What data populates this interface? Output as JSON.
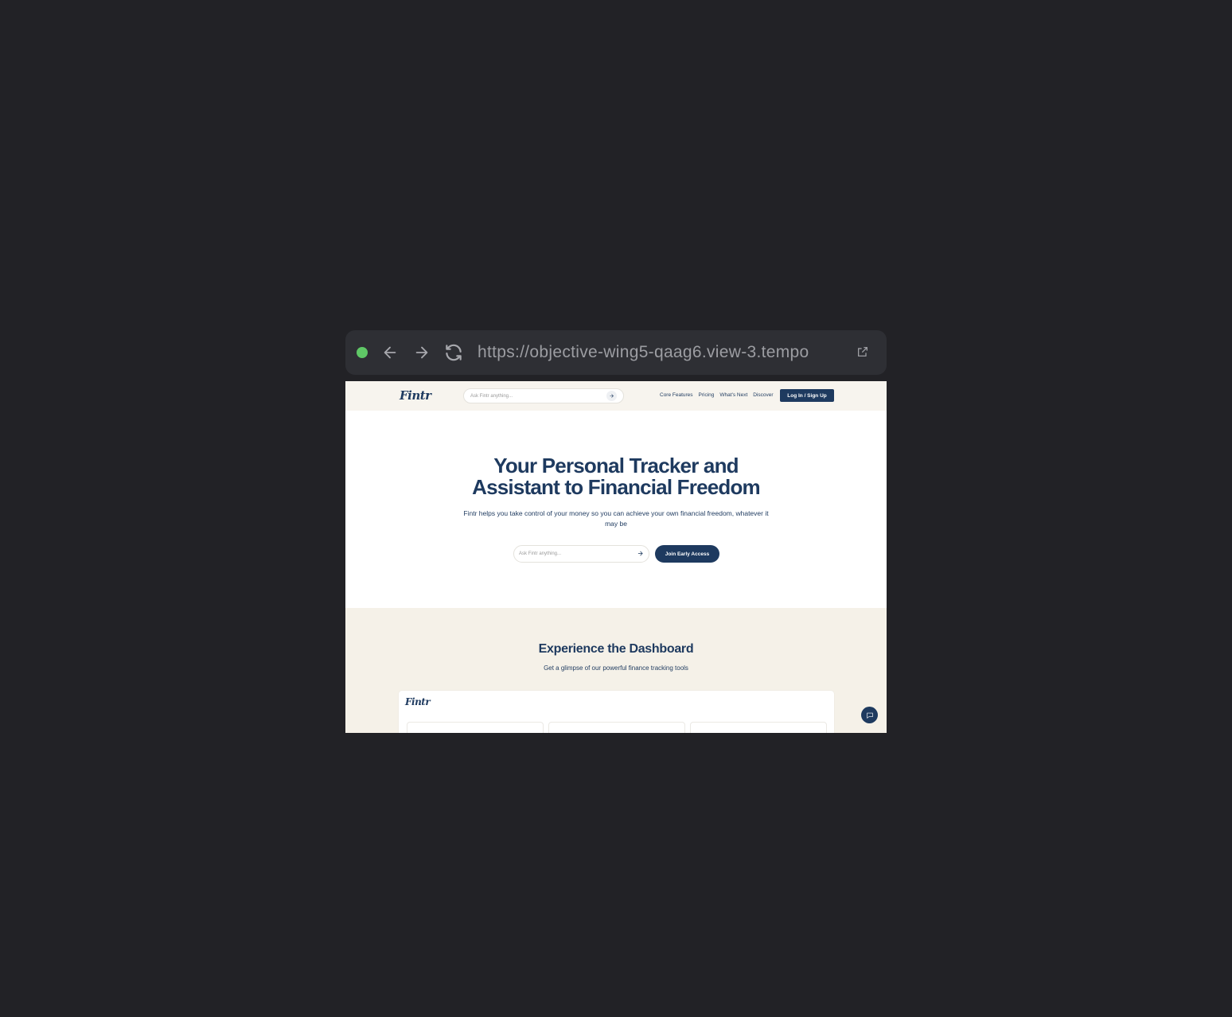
{
  "browser": {
    "url": "https://objective-wing5-qaag6.view-3.tempo",
    "status_color": "#5fc866",
    "icons": [
      "status-dot",
      "back-arrow-icon",
      "forward-arrow-icon",
      "reload-icon",
      "external-link-icon"
    ]
  },
  "site": {
    "brand": "Fintr",
    "brand_color": "#1e3a5f",
    "nav": {
      "search_placeholder": "Ask Fintr anything...",
      "links": [
        "Core Features",
        "Pricing",
        "What's Next",
        "Discover"
      ],
      "login_label": "Log In / Sign Up"
    },
    "hero": {
      "title_line1": "Your Personal Tracker and",
      "title_line2": "Assistant to Financial Freedom",
      "subtitle": "Fintr helps you take control of your money so you can achieve your own financial freedom, whatever it may be",
      "search_placeholder": "Ask Fintr anything...",
      "cta_label": "Join Early Access"
    },
    "dashboard": {
      "title": "Experience the Dashboard",
      "subtitle": "Get a glimpse of our powerful finance tracking tools",
      "card_brand": "Fintr"
    }
  }
}
